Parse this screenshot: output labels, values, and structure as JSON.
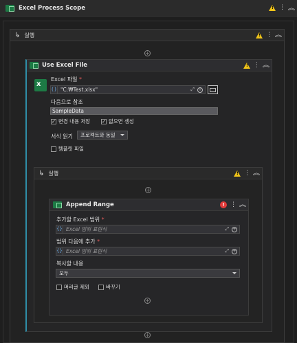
{
  "scope": {
    "title": "Excel Process Scope"
  },
  "outer_sequence": {
    "title": "실행"
  },
  "use_excel": {
    "title": "Use Excel File",
    "file_label": "Excel 파일",
    "file_required": "*",
    "file_value": "\"C:₩Test.xlsx\"",
    "ref_label": "다음으로 참조",
    "ref_value": "SampleData",
    "save_changes": "변경 내용 저장",
    "create_if_missing": "없으면 생성",
    "read_format_label": "서식 읽기",
    "read_format_value": "프로젝트와 동일",
    "template_file": "템플릿 파일"
  },
  "inner_sequence": {
    "title": "실행"
  },
  "append_range": {
    "title": "Append Range",
    "target_label": "추가할 Excel 범위",
    "target_required": "*",
    "target_placeholder": "Excel 범위 표현식",
    "dest_label": "범위 다음에 추가",
    "dest_required": "*",
    "dest_placeholder": "Excel 범위 표현식",
    "copy_label": "복사할 내용",
    "copy_value": "모두",
    "exclude_headers": "머리글 제외",
    "transpose": "바꾸기"
  },
  "icons": {
    "fx": "{}",
    "plus": "+",
    "kebab": "⋮",
    "collapse": "︽",
    "seq": "↳"
  }
}
